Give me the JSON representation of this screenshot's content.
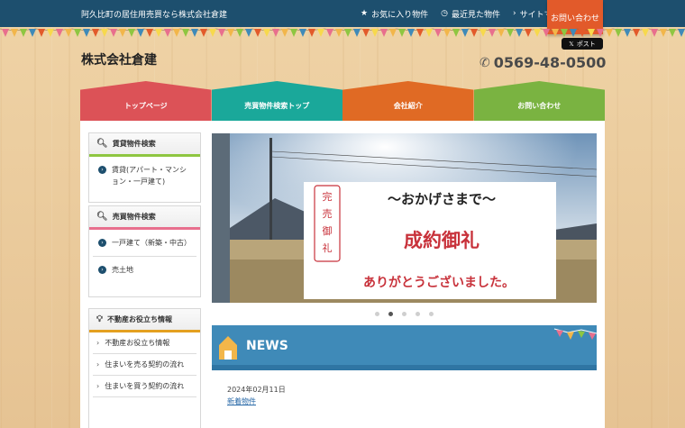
{
  "topbar": {
    "tagline": "阿久比町の居住用売買なら株式会社倉建",
    "links": [
      {
        "icon": "star-icon",
        "label": "お気に入り物件"
      },
      {
        "icon": "clock-icon",
        "label": "最近見た物件"
      },
      {
        "icon": "chevron-right-icon",
        "label": "サイトマップ"
      }
    ],
    "contact": "お問い合わせ"
  },
  "header": {
    "logo": "株式会社倉建",
    "post_button": "ポスト",
    "phone": "0569-48-0500"
  },
  "mainnav": {
    "items": [
      {
        "label": "トップページ",
        "color": "#dc5257"
      },
      {
        "label": "売買物件検索トップ",
        "color": "#1aa89a"
      },
      {
        "label": "会社紹介",
        "color": "#e06a24"
      },
      {
        "label": "お問い合わせ",
        "color": "#7ab341"
      }
    ]
  },
  "sidebar": {
    "rent": {
      "title": "賃貸物件検索",
      "items": [
        "賃貸(アパート・マンション・一戸建て)"
      ]
    },
    "sale": {
      "title": "売買物件検索",
      "items": [
        "一戸建て（新築・中古）",
        "売土地"
      ]
    },
    "info": {
      "title": "不動産お役立ち情報",
      "items": [
        "不動産お役立ち情報",
        "住まいを売る契約の流れ",
        "住まいを買う契約の流れ"
      ]
    }
  },
  "slider": {
    "sign_line1": "〜おかげさまで〜",
    "sign_line2": "成約御礼",
    "sign_line3": "ありがとうございました。",
    "stamp": "完売御礼",
    "slide_count": 5,
    "active_index": 1
  },
  "news": {
    "title": "NEWS",
    "entries": [
      {
        "date": "2024年02月11日",
        "link": "新着物件"
      }
    ]
  },
  "colors": {
    "navy": "#1d4f6e",
    "contact": "#e25a2a",
    "news": "#3f8ab8"
  }
}
